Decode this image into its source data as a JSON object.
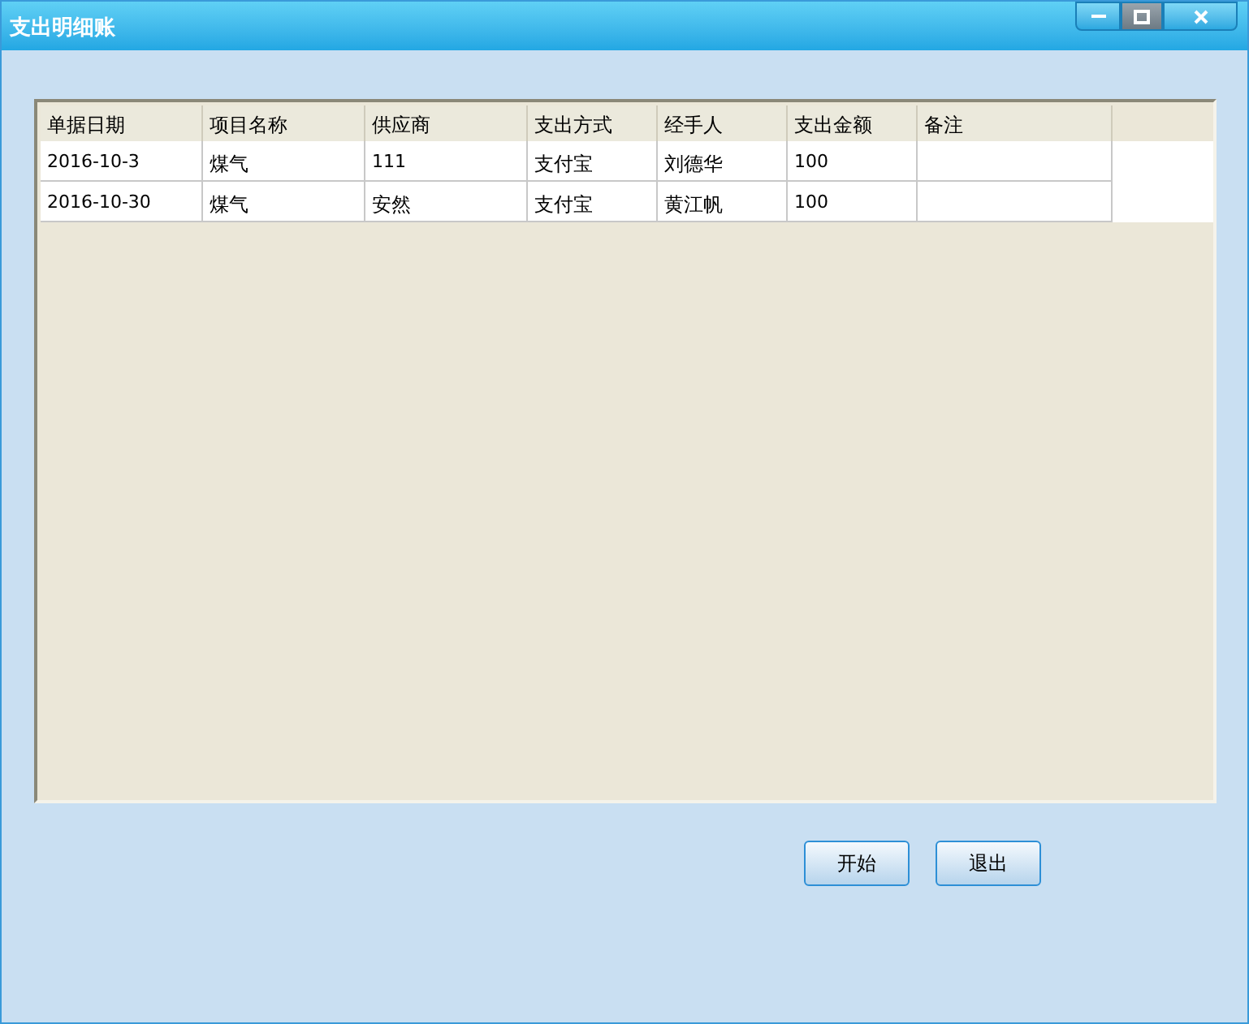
{
  "window": {
    "title": "支出明细账"
  },
  "table": {
    "columns": [
      "单据日期",
      "项目名称",
      "供应商",
      "支出方式",
      "经手人",
      "支出金额",
      "备注"
    ],
    "rows": [
      [
        "2016-10-3",
        "煤气",
        "111",
        "支付宝",
        "刘德华",
        "100",
        null
      ],
      [
        "2016-10-30",
        "煤气",
        "安然",
        "支付宝",
        "黄江帆",
        "100",
        null
      ]
    ]
  },
  "buttons": [
    "开始",
    "退出"
  ]
}
